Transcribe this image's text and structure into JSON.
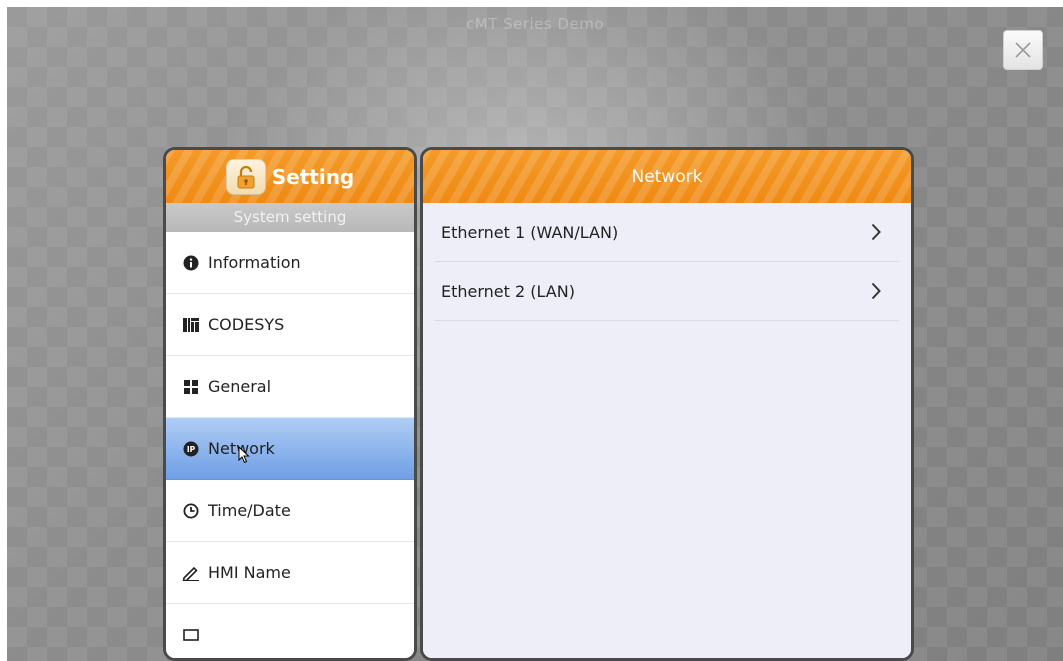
{
  "window": {
    "title": "cMT Series Demo"
  },
  "setting_panel": {
    "title": "Setting",
    "section": "System setting",
    "items": [
      {
        "label": "Information",
        "icon": "info-icon"
      },
      {
        "label": "CODESYS",
        "icon": "codesys-icon"
      },
      {
        "label": "General",
        "icon": "grid-icon"
      },
      {
        "label": "Network",
        "icon": "ip-icon",
        "active": true
      },
      {
        "label": "Time/Date",
        "icon": "clock-icon"
      },
      {
        "label": "HMI Name",
        "icon": "pencil-icon"
      }
    ]
  },
  "network_panel": {
    "title": "Network",
    "items": [
      {
        "label": "Ethernet 1 (WAN/LAN)"
      },
      {
        "label": "Ethernet 2 (LAN)"
      }
    ]
  },
  "colors": {
    "header_orange": "#f0901c",
    "active_blue": "#86aeea",
    "panel_bg": "#eeeef8"
  }
}
